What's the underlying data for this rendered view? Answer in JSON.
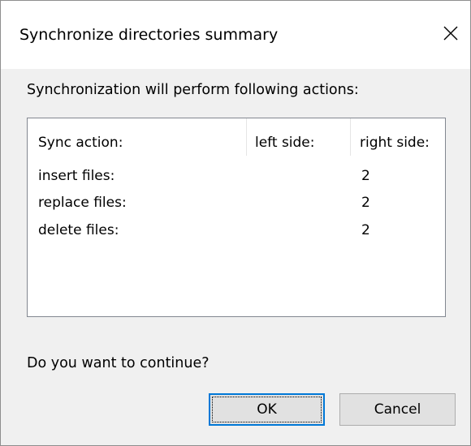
{
  "dialog": {
    "title": "Synchronize directories summary",
    "message": "Synchronization will perform following actions:",
    "question": "Do you want to continue?"
  },
  "table": {
    "headers": [
      "Sync action:",
      "left side:",
      "right side:"
    ],
    "rows": [
      {
        "action": "insert files:",
        "left": "",
        "right": "2"
      },
      {
        "action": "replace files:",
        "left": "",
        "right": "2"
      },
      {
        "action": "delete files:",
        "left": "",
        "right": "2"
      }
    ]
  },
  "buttons": {
    "ok_label": "OK",
    "cancel_label": "Cancel"
  },
  "icons": {
    "close": "close-icon"
  },
  "colors": {
    "accent": "#0078d7",
    "dialog_bg": "#f0f0f0"
  }
}
